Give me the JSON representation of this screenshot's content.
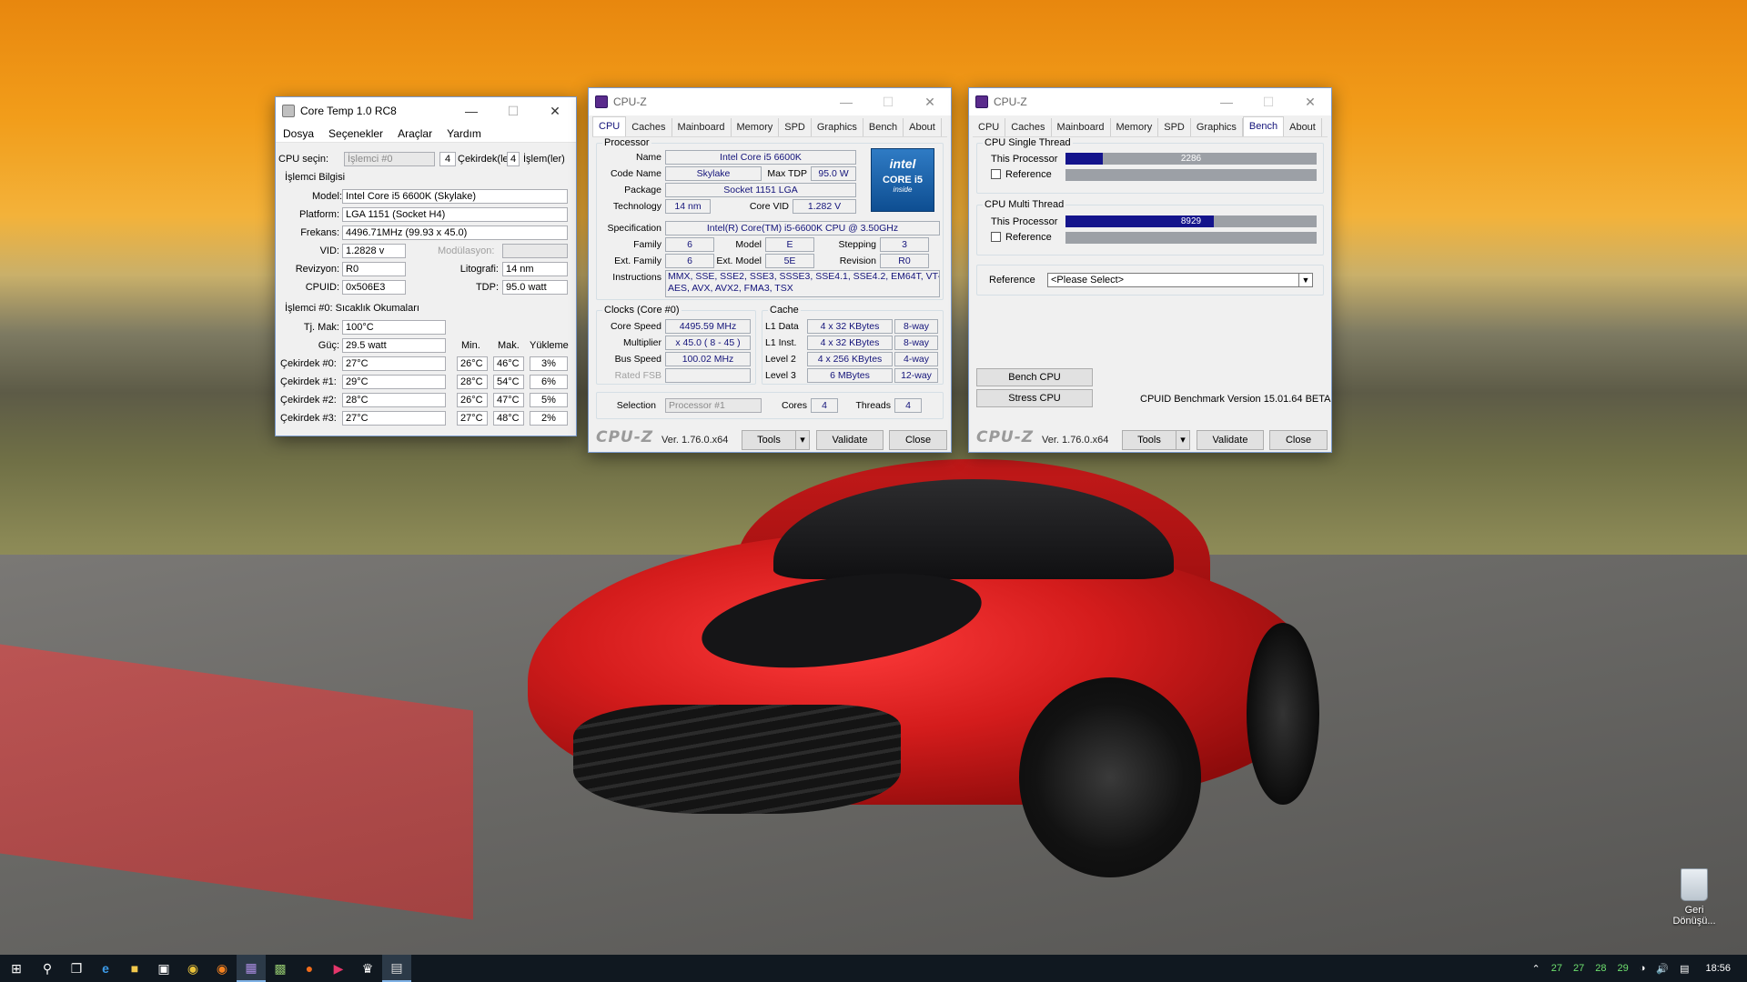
{
  "desktop": {
    "recycle_bin_label": "Geri\nDönüşü..."
  },
  "coretemp": {
    "title": "Core Temp 1.0 RC8",
    "menu": [
      "Dosya",
      "Seçenekler",
      "Araçlar",
      "Yardım"
    ],
    "cpu_select_label": "CPU seçin:",
    "cpu_select_value": "İşlemci #0",
    "cores_count": "4",
    "cores_label": "Çekirdek(le",
    "threads_count": "4",
    "threads_label": "İşlem(ler)",
    "info_header": "İşlemci Bilgisi",
    "model_label": "Model:",
    "model_value": "Intel Core i5 6600K (Skylake)",
    "platform_label": "Platform:",
    "platform_value": "LGA 1151 (Socket H4)",
    "freq_label": "Frekans:",
    "freq_value": "4496.71MHz (99.93 x 45.0)",
    "vid_label": "VID:",
    "vid_value": "1.2828 v",
    "modulation_label": "Modülasyon:",
    "revision_label": "Revizyon:",
    "revision_value": "R0",
    "litho_label": "Litografi:",
    "litho_value": "14 nm",
    "cpuid_label": "CPUID:",
    "cpuid_value": "0x506E3",
    "tdp_label": "TDP:",
    "tdp_value": "95.0 watt",
    "temp_header": "İşlemci #0: Sıcaklık Okumaları",
    "tjmax_label": "Tj. Mak:",
    "tjmax_value": "100°C",
    "power_label": "Güç:",
    "power_value": "29.5 watt",
    "col_min": "Min.",
    "col_max": "Mak.",
    "col_load": "Yükleme",
    "cores": [
      {
        "label": "Çekirdek #0:",
        "temp": "27°C",
        "min": "26°C",
        "max": "46°C",
        "load": "3%"
      },
      {
        "label": "Çekirdek #1:",
        "temp": "29°C",
        "min": "28°C",
        "max": "54°C",
        "load": "6%"
      },
      {
        "label": "Çekirdek #2:",
        "temp": "28°C",
        "min": "26°C",
        "max": "47°C",
        "load": "5%"
      },
      {
        "label": "Çekirdek #3:",
        "temp": "27°C",
        "min": "27°C",
        "max": "48°C",
        "load": "2%"
      }
    ]
  },
  "cpuz1": {
    "title": "CPU-Z",
    "tabs": [
      "CPU",
      "Caches",
      "Mainboard",
      "Memory",
      "SPD",
      "Graphics",
      "Bench",
      "About"
    ],
    "processor_group": "Processor",
    "name_label": "Name",
    "name_value": "Intel Core i5 6600K",
    "codename_label": "Code Name",
    "codename_value": "Skylake",
    "maxtdp_label": "Max TDP",
    "maxtdp_value": "95.0 W",
    "package_label": "Package",
    "package_value": "Socket 1151 LGA",
    "tech_label": "Technology",
    "tech_value": "14 nm",
    "corevid_label": "Core VID",
    "corevid_value": "1.282 V",
    "logo_brand": "intel",
    "logo_line1": "CORE i5",
    "logo_line2": "inside",
    "spec_label": "Specification",
    "spec_value": "Intel(R) Core(TM) i5-6600K CPU @ 3.50GHz",
    "family_label": "Family",
    "family_value": "6",
    "model_label": "Model",
    "model_value": "E",
    "stepping_label": "Stepping",
    "stepping_value": "3",
    "extfamily_label": "Ext. Family",
    "extfamily_value": "6",
    "extmodel_label": "Ext. Model",
    "extmodel_value": "5E",
    "revision_label": "Revision",
    "revision_value": "R0",
    "instr_label": "Instructions",
    "instr_line1": "MMX, SSE, SSE2, SSE3, SSSE3, SSE4.1, SSE4.2, EM64T, VT-x,",
    "instr_line2": "AES, AVX, AVX2, FMA3, TSX",
    "clocks_group": "Clocks (Core #0)",
    "corespeed_label": "Core Speed",
    "corespeed_value": "4495.59 MHz",
    "mult_label": "Multiplier",
    "mult_value": "x 45.0 ( 8 - 45 )",
    "bus_label": "Bus Speed",
    "bus_value": "100.02 MHz",
    "fsb_label": "Rated FSB",
    "fsb_value": "",
    "cache_group": "Cache",
    "l1d_label": "L1 Data",
    "l1d_value": "4 x 32 KBytes",
    "l1d_way": "8-way",
    "l1i_label": "L1 Inst.",
    "l1i_value": "4 x 32 KBytes",
    "l1i_way": "8-way",
    "l2_label": "Level 2",
    "l2_value": "4 x 256 KBytes",
    "l2_way": "4-way",
    "l3_label": "Level 3",
    "l3_value": "6 MBytes",
    "l3_way": "12-way",
    "selection_label": "Selection",
    "selection_value": "Processor #1",
    "cores_label": "Cores",
    "cores_value": "4",
    "threads_label": "Threads",
    "threads_value": "4",
    "logo": "CPU-Z",
    "version": "Ver. 1.76.0.x64",
    "tools": "Tools",
    "validate": "Validate",
    "close": "Close"
  },
  "cpuz2": {
    "title": "CPU-Z",
    "tabs": [
      "CPU",
      "Caches",
      "Mainboard",
      "Memory",
      "SPD",
      "Graphics",
      "Bench",
      "About"
    ],
    "single_group": "CPU Single Thread",
    "single_this_label": "This Processor",
    "single_this_value": "2286",
    "single_fraction": 0.15,
    "single_ref_label": "Reference",
    "multi_group": "CPU Multi Thread",
    "multi_this_label": "This Processor",
    "multi_this_value": "8929",
    "multi_fraction": 0.59,
    "multi_ref_label": "Reference",
    "reference_label": "Reference",
    "reference_value": "<Please Select>",
    "bench_cpu": "Bench CPU",
    "stress_cpu": "Stress CPU",
    "bench_version": "CPUID Benchmark Version 15.01.64 BETA",
    "logo": "CPU-Z",
    "version": "Ver. 1.76.0.x64",
    "tools": "Tools",
    "validate": "Validate",
    "close": "Close"
  },
  "taskbar": {
    "tray_temps": [
      "27",
      "27",
      "28",
      "29"
    ],
    "clock": "18:56"
  }
}
